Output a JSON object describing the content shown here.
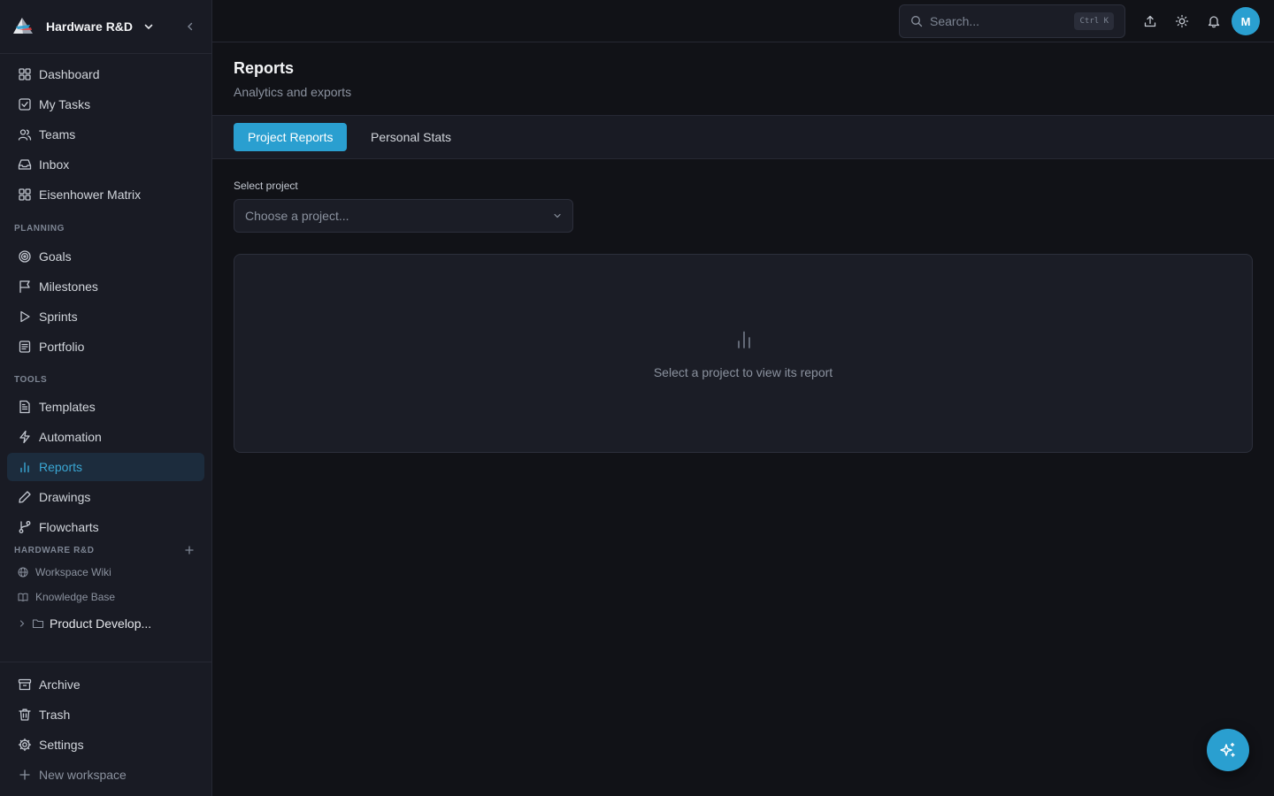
{
  "workspace": {
    "name": "Hardware R&D"
  },
  "nav": {
    "main": [
      {
        "label": "Dashboard",
        "icon": "dashboard-icon"
      },
      {
        "label": "My Tasks",
        "icon": "tasks-icon"
      },
      {
        "label": "Teams",
        "icon": "users-icon"
      },
      {
        "label": "Inbox",
        "icon": "inbox-icon"
      },
      {
        "label": "Eisenhower Matrix",
        "icon": "matrix-icon"
      }
    ],
    "planning_title": "PLANNING",
    "planning": [
      {
        "label": "Goals",
        "icon": "target-icon"
      },
      {
        "label": "Milestones",
        "icon": "flag-icon"
      },
      {
        "label": "Sprints",
        "icon": "play-icon"
      },
      {
        "label": "Portfolio",
        "icon": "portfolio-icon"
      }
    ],
    "tools_title": "TOOLS",
    "tools": [
      {
        "label": "Templates",
        "icon": "file-icon"
      },
      {
        "label": "Automation",
        "icon": "bolt-icon"
      },
      {
        "label": "Reports",
        "icon": "bar-chart-icon",
        "active": true
      },
      {
        "label": "Drawings",
        "icon": "pen-icon"
      },
      {
        "label": "Flowcharts",
        "icon": "flow-icon"
      }
    ],
    "workspace_section_title": "HARDWARE R&D",
    "workspace_links": [
      {
        "label": "Workspace Wiki",
        "icon": "globe-icon"
      },
      {
        "label": "Knowledge Base",
        "icon": "book-icon"
      }
    ],
    "folder": {
      "label": "Product Develop..."
    },
    "bottom": [
      {
        "label": "Archive",
        "icon": "archive-icon"
      },
      {
        "label": "Trash",
        "icon": "trash-icon"
      },
      {
        "label": "Settings",
        "icon": "gear-icon"
      },
      {
        "label": "New workspace",
        "icon": "plus-icon"
      }
    ]
  },
  "topbar": {
    "search_placeholder": "Search...",
    "shortcut": "Ctrl K",
    "avatar_initial": "M"
  },
  "page": {
    "title": "Reports",
    "subtitle": "Analytics and exports",
    "tabs": [
      {
        "label": "Project Reports",
        "active": true
      },
      {
        "label": "Personal Stats",
        "active": false
      }
    ],
    "select_label": "Select project",
    "select_placeholder": "Choose a project...",
    "empty_message": "Select a project to view its report"
  },
  "colors": {
    "accent": "#2a9fd0",
    "background": "#111217",
    "sidebar": "#191b24"
  }
}
